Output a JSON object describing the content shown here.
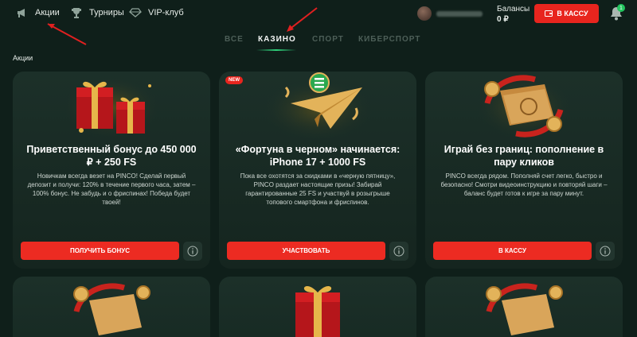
{
  "header": {
    "nav": [
      {
        "label": "Акции"
      },
      {
        "label": "Турниры"
      },
      {
        "label": "VIP-клуб"
      }
    ],
    "balance_label": "Балансы",
    "balance_value": "0 ₽",
    "cashier_label": "В КАССУ",
    "notification_count": "1"
  },
  "tabs": [
    {
      "label": "ВСЕ",
      "active": false
    },
    {
      "label": "КАЗИНО",
      "active": true
    },
    {
      "label": "СПОРТ",
      "active": false
    },
    {
      "label": "КИБЕРСПОРТ",
      "active": false
    }
  ],
  "section_title": "Акции",
  "cards": [
    {
      "title": "Приветственный бонус до 450 000 ₽ + 250 FS",
      "description": "Новичкам всегда везет на PINCO! Сделай первый депозит и получи: 120% в течение первого часа, затем – 100% бонус. Не забудь и о фриспинах! Победа будет твоей!",
      "button": "ПОЛУЧИТЬ БОНУС",
      "badge": ""
    },
    {
      "title": "«Фортуна в черном» начинается: iPhone 17 + 1000 FS",
      "description": "Пока все охотятся за скидками в «черную пятницу», PINCO раздает настоящие призы! Забирай гарантированные 25 FS и участвуй в розыгрыше топового смартфона и фриспинов.",
      "button": "УЧАСТВОВАТЬ",
      "badge": "NEW"
    },
    {
      "title": "Играй без границ: пополнение в пару кликов",
      "description": "PINCO всегда рядом. Пополняй счет легко, быстро и безопасно! Смотри видеоинструкцию и повторяй шаги – баланс будет готов к игре за пару минут.",
      "button": "В КАССУ",
      "badge": ""
    }
  ],
  "colors": {
    "background": "#0f1f1a",
    "card": "#1c3029",
    "accent_red": "#e8251e",
    "accent_green": "#2fd07a"
  }
}
